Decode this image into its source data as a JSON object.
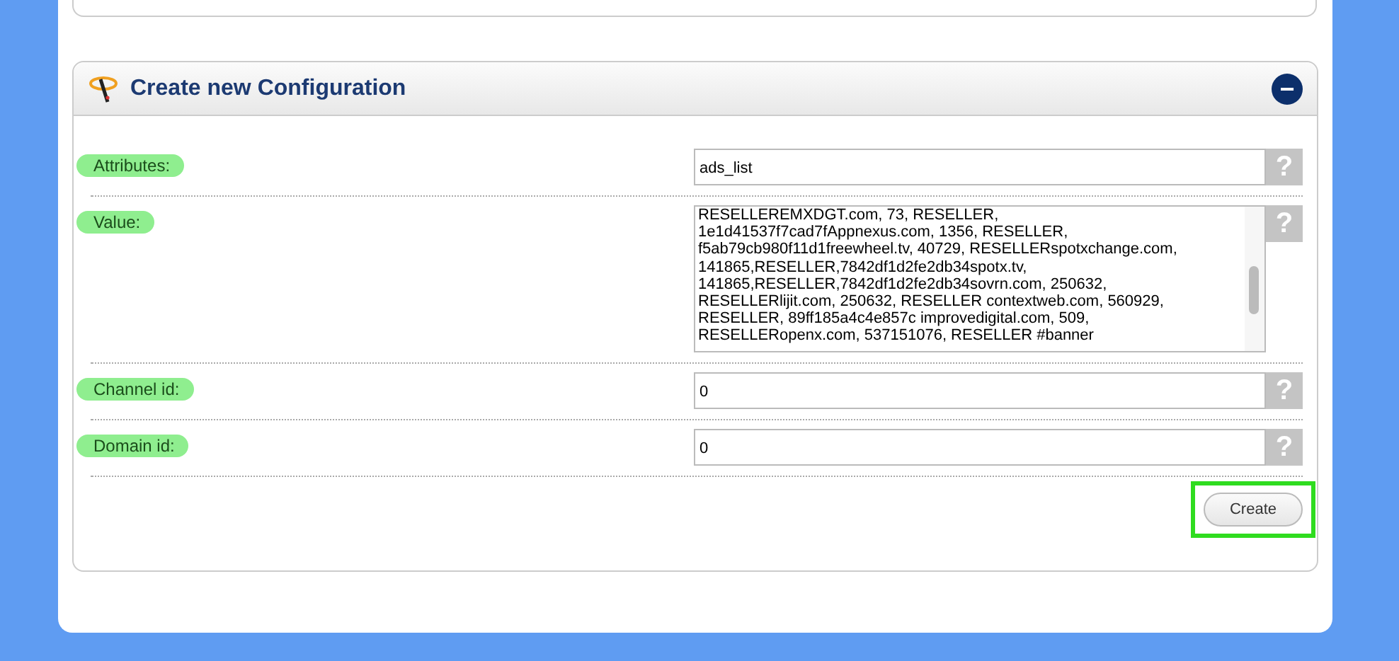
{
  "panel": {
    "title": "Create new Configuration",
    "collapse_button": "−"
  },
  "fields": [
    {
      "kind": "input",
      "label": "Attributes:",
      "value": "ads_list",
      "help": "?"
    },
    {
      "kind": "textarea",
      "label": "Value:",
      "lines": [
        "RESELLEREMXDGT.com, 73, RESELLER,",
        "1e1d41537f7cad7fAppnexus.com, 1356, RESELLER,",
        "f5ab79cb980f11d1freewheel.tv, 40729, RESELLERspotxchange.com,",
        "141865,RESELLER,7842df1d2fe2db34spotx.tv,",
        "141865,RESELLER,7842df1d2fe2db34sovrn.com, 250632,",
        "RESELLERlijit.com, 250632, RESELLER contextweb.com, 560929,",
        "RESELLER, 89ff185a4c4e857c improvedigital.com, 509,",
        "RESELLERopenx.com, 537151076, RESELLER #banner"
      ],
      "help": "?"
    },
    {
      "kind": "input",
      "label": "Channel id:",
      "value": "0",
      "help": "?"
    },
    {
      "kind": "input",
      "label": "Domain id:",
      "value": "0",
      "help": "?"
    }
  ],
  "create_button": {
    "label": "Create",
    "highlighted": true
  }
}
